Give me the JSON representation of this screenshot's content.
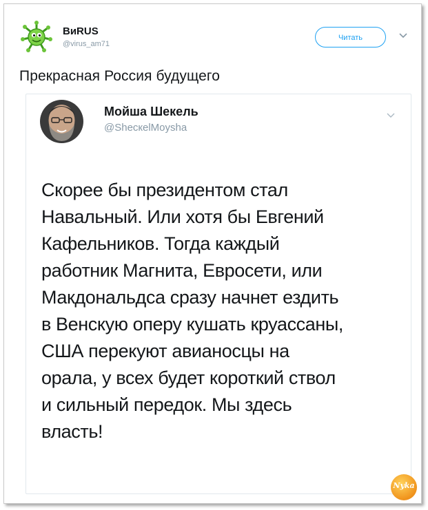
{
  "tweet": {
    "author_name": "BиRUS",
    "author_handle": "@virus_am71",
    "follow_label": "Читать",
    "text": "Прекрасная Россия будущего"
  },
  "quoted_tweet": {
    "author_name": "Мойша Шекель",
    "author_handle": "@ShecкelMoysha",
    "body": "Скорее бы президентом стал\nНавальный. Или хотя бы Евгений\nКафельников. Тогда каждый\nработник Магнита, Евросети, или\nМакдональдса сразу начнет ездить\nв Венскую оперу кушать круассаны,\nСША перекуют авианосцы на\nорала, у всех будет короткий ствол\nи сильный передок. Мы здесь\nвласть!"
  },
  "watermark": {
    "text": "Nyka"
  },
  "colors": {
    "accent": "#1da1f2",
    "text": "#14171a",
    "muted": "#8899a6",
    "border": "#e1e8ed"
  },
  "icons": {
    "author_avatar": "green-virus-icon",
    "menu": "chevron-down-icon"
  }
}
